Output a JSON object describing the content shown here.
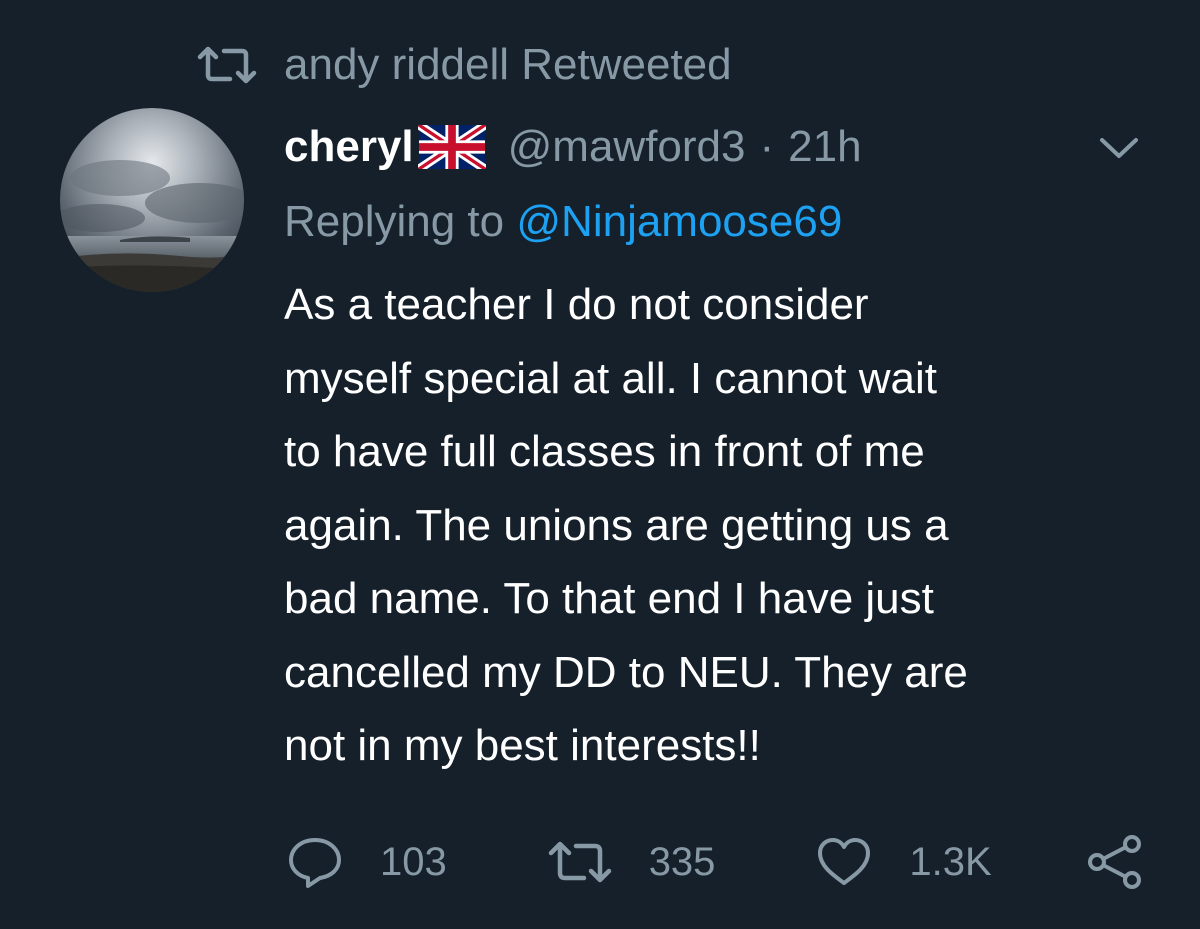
{
  "retweet_context": {
    "text": "andy riddell Retweeted",
    "icon": "retweet-icon"
  },
  "tweet": {
    "display_name": "cheryl",
    "flag_icon": "uk-flag-icon",
    "handle": "@mawford3",
    "separator": "·",
    "time": "21h",
    "more_icon": "chevron-down-icon",
    "replying_prefix": "Replying to",
    "replying_to": "@Ninjamoose69",
    "body_lines": [
      "As a teacher I do not consider",
      "myself special at all. I cannot wait",
      "to have full classes in front of me",
      "again. The unions are getting us a",
      "bad name. To that end I have just",
      "cancelled my DD to NEU. They are",
      "not in my best interests!!"
    ]
  },
  "actions": {
    "reply": {
      "icon": "reply-icon",
      "count": "103"
    },
    "retweet": {
      "icon": "retweet-icon",
      "count": "335"
    },
    "like": {
      "icon": "heart-icon",
      "count": "1.3K"
    },
    "share": {
      "icon": "share-icon"
    }
  },
  "colors": {
    "background": "#15202b",
    "secondary_text": "#8899a6",
    "link": "#1da1f2",
    "primary_text": "#ffffff"
  }
}
